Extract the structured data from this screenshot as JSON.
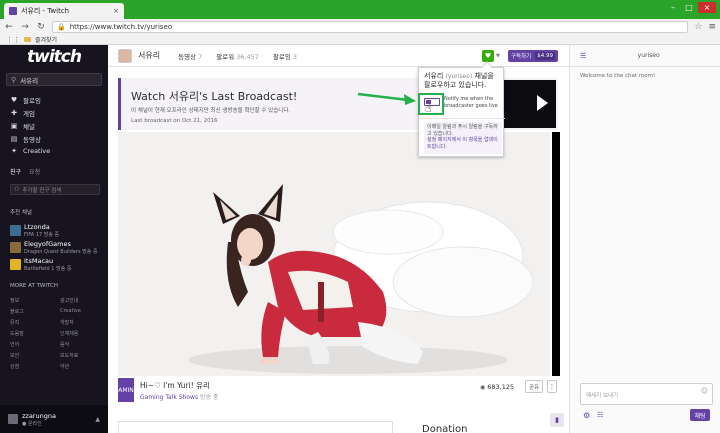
{
  "browser": {
    "tab_title": "서유리 - Twitch",
    "tab_close": "×",
    "url": "https://www.twitch.tv/yuriseo",
    "bookmark": "즐겨찾기",
    "win_min": "–",
    "win_max": "□",
    "win_close": "×"
  },
  "sidebar": {
    "logo": "twitch",
    "search_value": "서유리",
    "nav": [
      {
        "label": "팔로잉",
        "icon": "heart-icon"
      },
      {
        "label": "게임",
        "icon": "gamepad-icon"
      },
      {
        "label": "채널",
        "icon": "video-icon"
      },
      {
        "label": "동영상",
        "icon": "film-icon"
      },
      {
        "label": "Creative",
        "icon": "sparkle-icon"
      }
    ],
    "friends_tab": "친구",
    "friends_sub": "요청",
    "friend_search_placeholder": "추가할 친구 검색",
    "recommended_title": "추천 채널",
    "recommended": [
      {
        "name": "Ltzonda",
        "game": "FIFA 17 방송 중",
        "color": "#3b6e8f"
      },
      {
        "name": "ElegyofGames",
        "game": "Dragon Quest Builders 방송 중",
        "color": "#8a6b3d"
      },
      {
        "name": "ItsMacau",
        "game": "Battlefield 1 방송 중",
        "color": "#e0b624"
      }
    ],
    "more_title": "MORE AT TWITCH",
    "more_links": [
      "정보",
      "광고안내",
      "블로그",
      "Creative",
      "뮤직",
      "개발자",
      "도움말",
      "인재채용",
      "언어",
      "음악",
      "보안",
      "보도자료",
      "상점",
      "약관"
    ],
    "user_name": "zzarungna",
    "user_status": "● 온라인"
  },
  "channel": {
    "name": "서유리",
    "stats": [
      {
        "label": "동영상",
        "value": "7"
      },
      {
        "label": "팔로워",
        "value": "36,457"
      },
      {
        "label": "팔로잉",
        "value": "3"
      }
    ],
    "subscribe_label": "구독하기",
    "subscribe_price": "$4.99"
  },
  "banner": {
    "title": "Watch 서유리's Last Broadcast!",
    "desc": "이 채널이 현재 오프라인 상태지만 최신 생방송을 확인할 수 있습니다.",
    "date": "Last broadcast on Oct 21, 2016"
  },
  "stream": {
    "logo": "GAMING",
    "title": "Hi~♡ I'm Yuri! 유리",
    "game": "Gaming Talk Shows",
    "game_suffix": " 방송 중",
    "viewers": "683,125",
    "share_label": "공유",
    "more_label": "⋮",
    "donation": "Donation"
  },
  "popup": {
    "title": "서유리",
    "title_id": "(yuriseo)",
    "title_rest": " 채널을 팔로우하고 있습니다.",
    "toggle_text": "Notify me when the broadcaster goes live",
    "info_1": "이메일 알림과 푸시 알림을 구독하고 있습니다.",
    "info_2": "설정 페이지에서 이 항목을 업데이트합니다."
  },
  "chat": {
    "channel": "yuriseo",
    "welcome": "Welcome to the chat room!",
    "placeholder": "메세지 보내기",
    "send_label": "채팅"
  },
  "colors": {
    "twitch_purple": "#6441a5",
    "follow_green": "#34ae0a",
    "annotation_green": "#22b14c",
    "sidebar_bg": "#17141f",
    "chrome_green": "#2aa52a"
  }
}
